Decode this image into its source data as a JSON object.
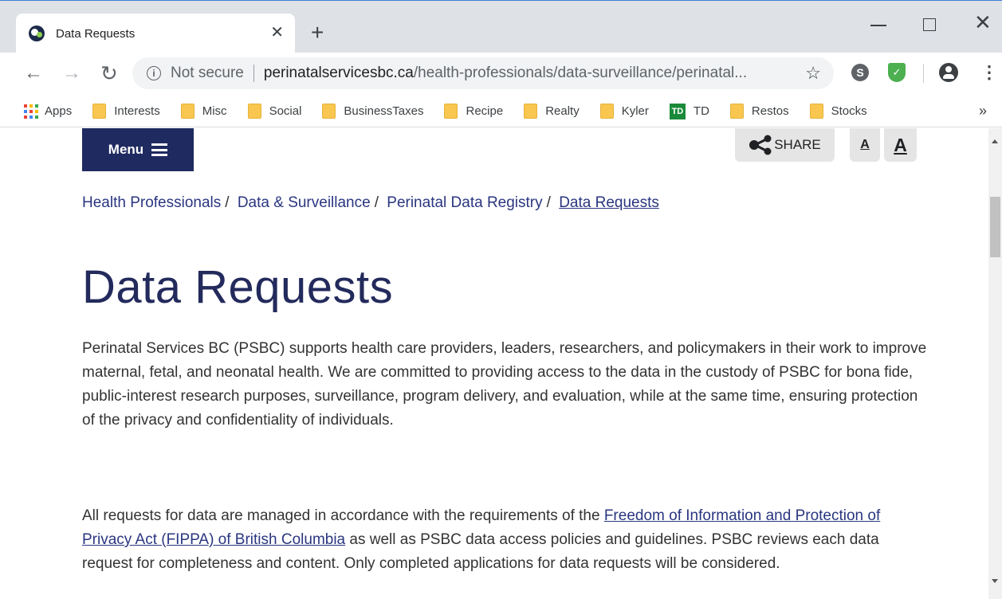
{
  "browser": {
    "tab_title": "Data Requests",
    "not_secure": "Not secure",
    "url_host": "perinatalservicesbc.ca",
    "url_path": "/health-professionals/data-surveillance/perinatal...",
    "ext_skype_letter": "S",
    "bookmarks": [
      {
        "label": "Apps",
        "icon": "apps-grid-icon"
      },
      {
        "label": "Interests",
        "icon": "folder-icon"
      },
      {
        "label": "Misc",
        "icon": "folder-icon"
      },
      {
        "label": "Social",
        "icon": "folder-icon"
      },
      {
        "label": "BusinessTaxes",
        "icon": "folder-icon"
      },
      {
        "label": "Recipe",
        "icon": "folder-icon"
      },
      {
        "label": "Realty",
        "icon": "folder-icon"
      },
      {
        "label": "Kyler",
        "icon": "folder-icon"
      },
      {
        "label": "TD",
        "icon": "td-icon"
      },
      {
        "label": "Restos",
        "icon": "folder-icon"
      },
      {
        "label": "Stocks",
        "icon": "folder-icon"
      }
    ],
    "td_icon_text": "TD"
  },
  "header": {
    "menu_label": "Menu",
    "share_label": "SHARE",
    "font_small_label": "A",
    "font_large_label": "A"
  },
  "breadcrumb": {
    "items": [
      "Health Professionals",
      "Data & Surveillance",
      "Perinatal Data Registry"
    ],
    "current": "Data Requests",
    "separator": "/"
  },
  "main": {
    "title": "Data Requests",
    "paragraph1": "Perinatal Services BC (PSBC) supports health care providers, leaders, researchers, and policymakers in their work to improve maternal, fetal, and neonatal health. We are committed to providing access to the data in the custody of PSBC for bona fide, public-interest research purposes, surveillance, program delivery, and evaluation, while at the same time, ensuring protection of the privacy and confidentiality of individuals.",
    "paragraph2_before": "All requests for data are managed in accordance with the requirements of the ",
    "paragraph2_link": "Freedom of Information and Protection of Privacy Act (FIPPA) of British Columbia",
    "paragraph2_after": " as well as PSBC data access policies and guidelines. PSBC reviews each data request for completeness and content. Only completed applications for data requests will be considered."
  },
  "colors": {
    "brand_navy": "#1f2a60",
    "link": "#2a3680",
    "title": "#232a5c"
  }
}
